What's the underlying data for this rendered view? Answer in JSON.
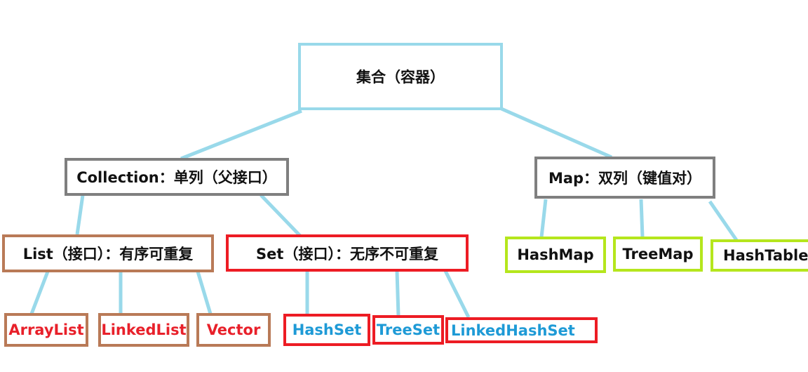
{
  "colors": {
    "connector": "#99d9ea",
    "root_border": "#99d9ea",
    "gray_border": "#7f7f7f",
    "brown_border": "#b97a57",
    "red_border": "#ed1c24",
    "green_border": "#b5e61d",
    "red_text": "#e8202a",
    "blue_text": "#1e9ad6"
  },
  "root": {
    "label": "集合（容器）"
  },
  "collection": {
    "label": "Collection：单列（父接口）"
  },
  "map": {
    "label": "Map：双列（键值对）"
  },
  "list": {
    "label": "List（接口）：有序可重复"
  },
  "set": {
    "label": "Set（接口）：无序不可重复"
  },
  "list_impls": [
    "ArrayList",
    "LinkedList",
    "Vector"
  ],
  "set_impls": [
    "HashSet",
    "TreeSet",
    "LinkedHashSet"
  ],
  "map_impls": [
    "HashMap",
    "TreeMap",
    "HashTable"
  ]
}
